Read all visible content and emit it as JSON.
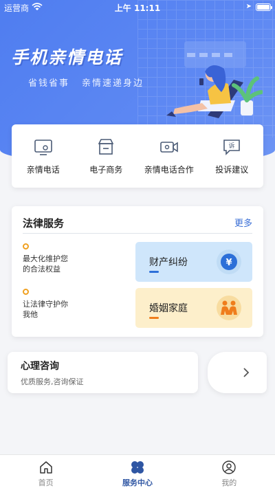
{
  "status_bar": {
    "carrier": "运营商",
    "time": "上午 11:11"
  },
  "hero": {
    "title": "手机亲情电话",
    "subtitle_1": "省钱省事",
    "subtitle_2": "亲情速递身边"
  },
  "categories": [
    {
      "label": "亲情电话",
      "icon": "phone-screen-icon"
    },
    {
      "label": "电子商务",
      "icon": "shop-icon"
    },
    {
      "label": "亲情电话合作",
      "icon": "video-camera-icon"
    },
    {
      "label": "投诉建议",
      "icon": "complaint-icon"
    }
  ],
  "legal": {
    "title": "法律服务",
    "more": "更多",
    "bullet_1": "最大化维护您\n的合法权益",
    "bullet_2": "让法律守护你\n我他",
    "tile_1": "财产纠纷",
    "tile_1_icon_text": "¥",
    "tile_2": "婚姻家庭"
  },
  "psychology": {
    "title": "心理咨询",
    "desc": "优质服务,咨询保证"
  },
  "tabs": [
    {
      "label": "首页",
      "icon": "home-icon",
      "active": false
    },
    {
      "label": "服务中心",
      "icon": "service-center-icon",
      "active": true
    },
    {
      "label": "我的",
      "icon": "profile-icon",
      "active": false
    }
  ],
  "colors": {
    "primary": "#4f7df0",
    "link": "#3b6fd6",
    "tab_active": "#2f56a3",
    "accent_orange": "#ef7d1c"
  }
}
